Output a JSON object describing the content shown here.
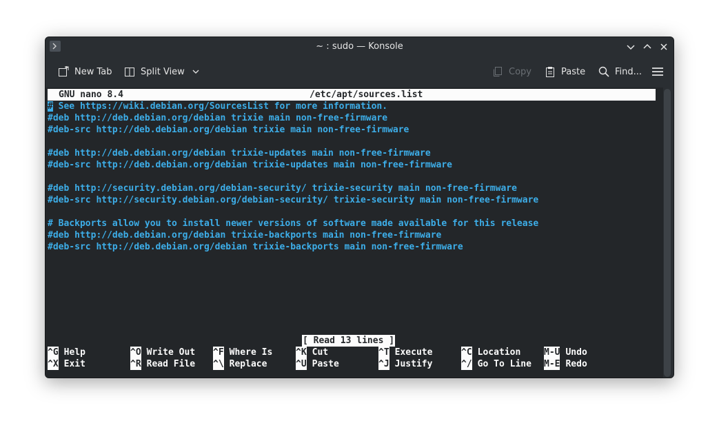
{
  "window": {
    "title": "~ : sudo — Konsole"
  },
  "toolbar": {
    "new_tab": "New Tab",
    "split_view": "Split View",
    "copy": "Copy",
    "paste": "Paste",
    "find": "Find..."
  },
  "nano": {
    "version": "GNU nano 8.4",
    "filename": "/etc/apt/sources.list",
    "lines": [
      "# See https://wiki.debian.org/SourcesList for more information.",
      "#deb http://deb.debian.org/debian trixie main non-free-firmware",
      "#deb-src http://deb.debian.org/debian trixie main non-free-firmware",
      "",
      "#deb http://deb.debian.org/debian trixie-updates main non-free-firmware",
      "#deb-src http://deb.debian.org/debian trixie-updates main non-free-firmware",
      "",
      "#deb http://security.debian.org/debian-security/ trixie-security main non-free-firmware",
      "#deb-src http://security.debian.org/debian-security/ trixie-security main non-free-firmware",
      "",
      "# Backports allow you to install newer versions of software made available for this release",
      "#deb http://deb.debian.org/debian trixie-backports main non-free-firmware",
      "#deb-src http://deb.debian.org/debian trixie-backports main non-free-firmware"
    ],
    "status": "[ Read 13 lines ]",
    "shortcuts_row1": [
      {
        "key": "^G",
        "label": "Help"
      },
      {
        "key": "^O",
        "label": "Write Out"
      },
      {
        "key": "^F",
        "label": "Where Is"
      },
      {
        "key": "^K",
        "label": "Cut"
      },
      {
        "key": "^T",
        "label": "Execute"
      },
      {
        "key": "^C",
        "label": "Location"
      },
      {
        "key": "M-U",
        "label": "Undo"
      }
    ],
    "shortcuts_row2": [
      {
        "key": "^X",
        "label": "Exit"
      },
      {
        "key": "^R",
        "label": "Read File"
      },
      {
        "key": "^\\",
        "label": "Replace"
      },
      {
        "key": "^U",
        "label": "Paste"
      },
      {
        "key": "^J",
        "label": "Justify"
      },
      {
        "key": "^/",
        "label": "Go To Line"
      },
      {
        "key": "M-E",
        "label": "Redo"
      }
    ]
  },
  "colors": {
    "text": "#3daee9",
    "background": "#232629",
    "highlight": "#fcfcfc"
  }
}
